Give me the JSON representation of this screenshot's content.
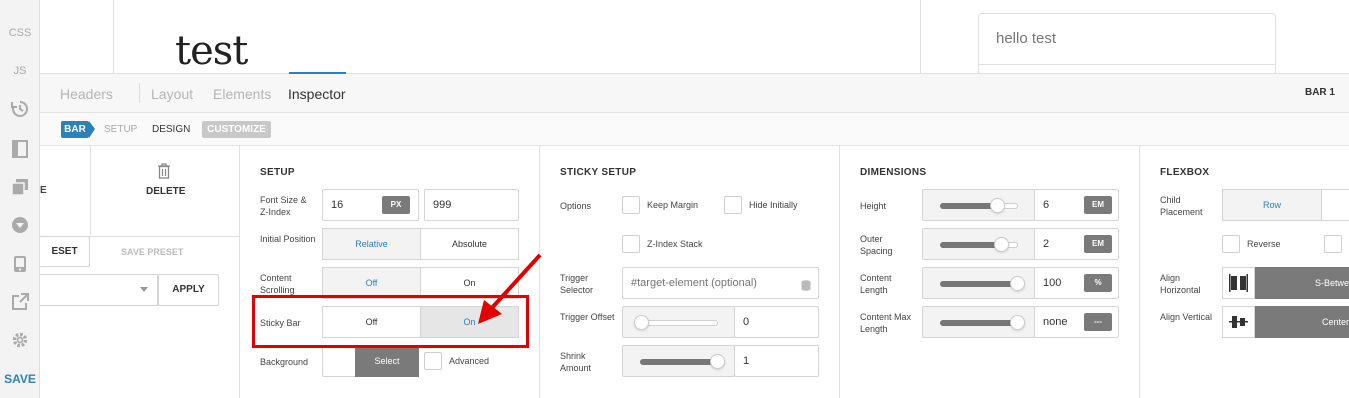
{
  "rail": {
    "css": "CSS",
    "js": "JS",
    "save": "SAVE",
    "icons": [
      "history-icon",
      "layout-icon",
      "copy-icon",
      "dropdown-icon",
      "mobile-icon",
      "external-link-icon",
      "gear-icon"
    ]
  },
  "preview": {
    "title": "test",
    "card_text": "hello test"
  },
  "tabs": {
    "items": [
      "Headers",
      "Layout",
      "Elements",
      "Inspector"
    ],
    "active": "Inspector",
    "bar_label": "BAR 1"
  },
  "breadcrumb": {
    "bar": "BAR",
    "setup": "SETUP",
    "design": "DESIGN",
    "customize": "CUSTOMIZE"
  },
  "left_panel": {
    "delete_label": "DELETE",
    "edge_label": "E",
    "reset_preset": "ESET",
    "save_preset": "SAVE PRESET",
    "apply": "APPLY"
  },
  "setup": {
    "title": "SETUP",
    "font_size_label": "Font Size & Z-Index",
    "font_size": "16",
    "font_unit": "PX",
    "z_index": "999",
    "initial_position_label": "Initial Position",
    "relative": "Relative",
    "absolute": "Absolute",
    "content_scrolling_label": "Content Scrolling",
    "off": "Off",
    "on": "On",
    "sticky_bar_label": "Sticky Bar",
    "background_label": "Background",
    "select": "Select",
    "advanced": "Advanced"
  },
  "sticky": {
    "title": "STICKY SETUP",
    "options_label": "Options",
    "keep_margin": "Keep Margin",
    "hide_initially": "Hide Initially",
    "z_index_stack": "Z-Index Stack",
    "trigger_selector_label": "Trigger Selector",
    "trigger_selector_placeholder": "#target-element (optional)",
    "trigger_offset_label": "Trigger Offset",
    "trigger_offset": "0",
    "shrink_amount_label": "Shrink Amount",
    "shrink_amount": "1",
    "trigger_offset_level": 0.0,
    "shrink_amount_level": 1.0
  },
  "dimensions": {
    "title": "DIMENSIONS",
    "height_label": "Height",
    "height": "6",
    "height_unit": "EM",
    "outer_spacing_label": "Outer Spacing",
    "outer_spacing": "2",
    "outer_spacing_unit": "EM",
    "content_length_label": "Content Length",
    "content_length": "100",
    "content_length_unit": "%",
    "content_max_label": "Content Max Length",
    "content_max": "none",
    "content_max_unit": "---"
  },
  "flexbox": {
    "title": "FLEXBOX",
    "child_placement_label": "Child Placement",
    "row": "Row",
    "reverse": "Reverse",
    "align_horizontal_label": "Align Horizontal",
    "align_horizontal": "S-Betwe",
    "align_vertical_label": "Align Vertical",
    "align_vertical": "Center"
  },
  "colors": {
    "accent": "#2e80b9",
    "highlight": "#e00000",
    "dark_button": "#7a7a7a"
  }
}
